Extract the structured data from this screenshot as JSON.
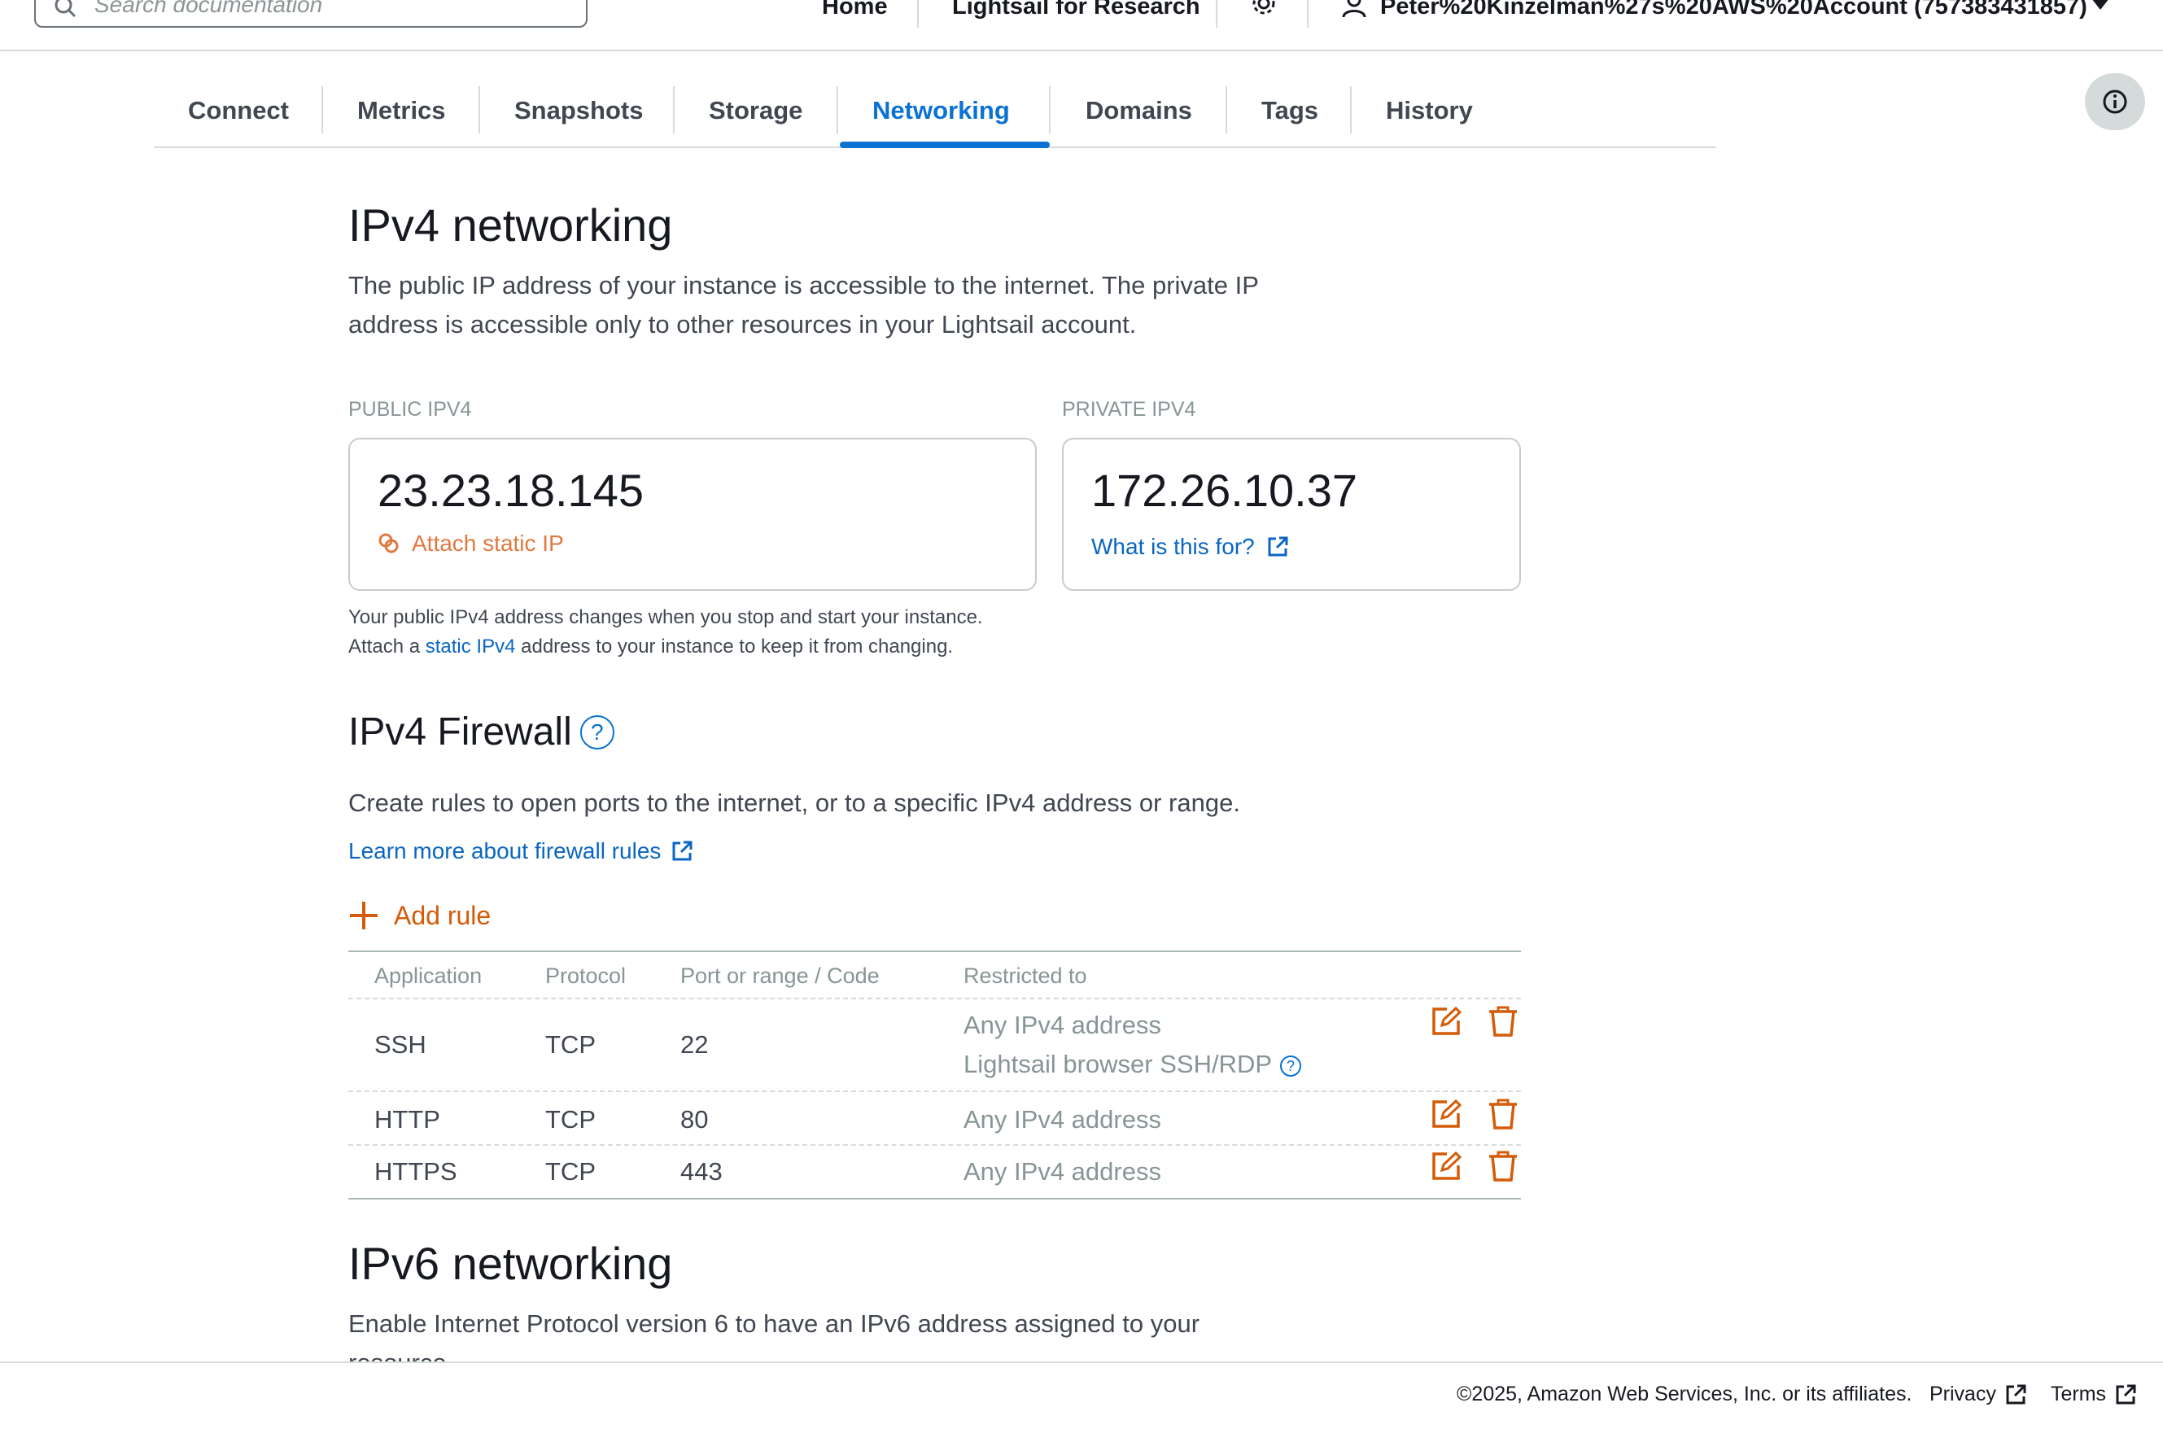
{
  "topbar": {
    "search_placeholder": "Search documentation",
    "home": "Home",
    "research": "Lightsail for Research",
    "account": "Peter%20Kinzelman%27s%20AWS%20Account (757383431857)"
  },
  "tabs": [
    "Connect",
    "Metrics",
    "Snapshots",
    "Storage",
    "Networking",
    "Domains",
    "Tags",
    "History"
  ],
  "active_tab": "Networking",
  "ipv4": {
    "title": "IPv4 networking",
    "desc_line1": "The public IP address of your instance is accessible to the internet. The private IP",
    "desc_line2": "address is accessible only to other resources in your Lightsail account.",
    "public_label": "PUBLIC IPV4",
    "public_ip": "23.23.18.145",
    "attach_static": "Attach static IP",
    "private_label": "PRIVATE IPV4",
    "private_ip": "172.26.10.37",
    "what_is_this": "What is this for?",
    "note_line1": "Your public IPv4 address changes when you stop and start your instance.",
    "note_pre": "Attach a ",
    "note_link": "static IPv4",
    "note_post": " address to your instance to keep it from changing."
  },
  "firewall": {
    "title": "IPv4 Firewall",
    "help": "?",
    "desc": "Create rules to open ports to the internet, or to a specific IPv4 address or range.",
    "learn_more": "Learn more about firewall rules",
    "add_rule": "Add rule",
    "columns": [
      "Application",
      "Protocol",
      "Port or range / Code",
      "Restricted to"
    ],
    "rows": [
      {
        "application": "SSH",
        "protocol": "TCP",
        "port": "22",
        "restricted": "Any IPv4 address",
        "restricted2": "Lightsail browser SSH/RDP"
      },
      {
        "application": "HTTP",
        "protocol": "TCP",
        "port": "80",
        "restricted": "Any IPv4 address"
      },
      {
        "application": "HTTPS",
        "protocol": "TCP",
        "port": "443",
        "restricted": "Any IPv4 address"
      }
    ]
  },
  "ipv6": {
    "title": "IPv6 networking",
    "desc_line1": "Enable Internet Protocol version 6 to have an IPv6 address assigned to your",
    "desc_line2": "resource."
  },
  "footer": {
    "copyright": "©2025, Amazon Web Services, Inc. or its affiliates.",
    "privacy": "Privacy",
    "terms": "Terms"
  },
  "colors": {
    "accent_blue": "#0972d3",
    "action_orange": "#d45b07",
    "attach_orange": "#e07941"
  }
}
